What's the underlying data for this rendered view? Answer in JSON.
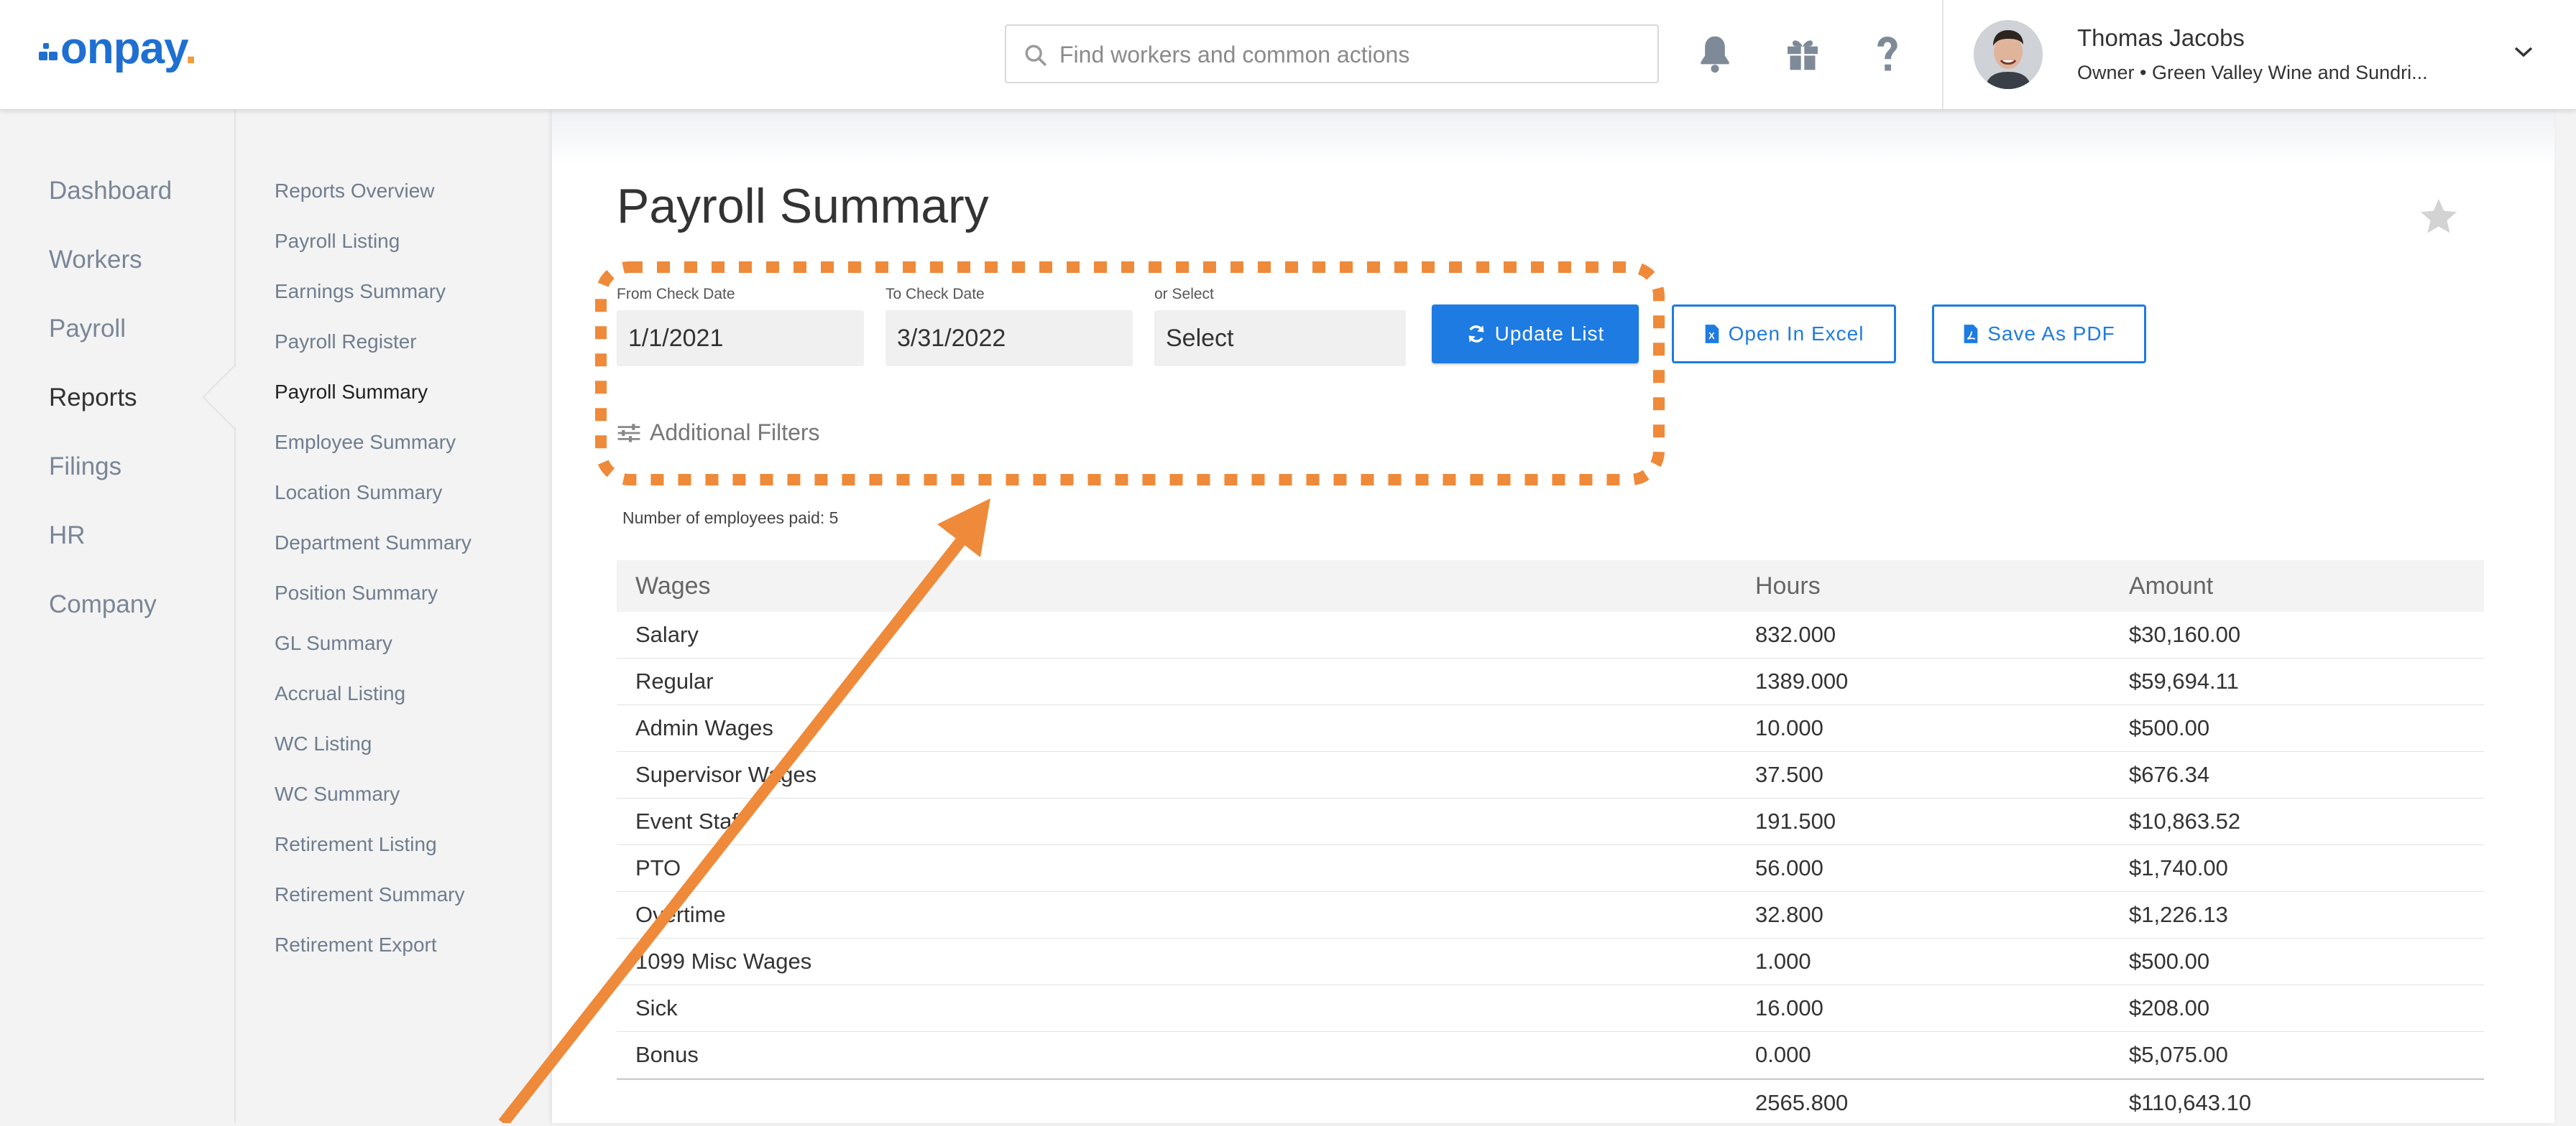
{
  "app": {
    "logo_text": "onpay",
    "logo_dot": "."
  },
  "header": {
    "search_placeholder": "Find workers and common actions",
    "user_name": "Thomas Jacobs",
    "user_sub": "Owner • Green Valley Wine and Sundri..."
  },
  "nav_primary": [
    {
      "label": "Dashboard"
    },
    {
      "label": "Workers"
    },
    {
      "label": "Payroll"
    },
    {
      "label": "Reports"
    },
    {
      "label": "Filings"
    },
    {
      "label": "HR"
    },
    {
      "label": "Company"
    }
  ],
  "nav_reports": [
    {
      "label": "Reports Overview"
    },
    {
      "label": "Payroll Listing"
    },
    {
      "label": "Earnings Summary"
    },
    {
      "label": "Payroll Register"
    },
    {
      "label": "Payroll Summary"
    },
    {
      "label": "Employee Summary"
    },
    {
      "label": "Location Summary"
    },
    {
      "label": "Department Summary"
    },
    {
      "label": "Position Summary"
    },
    {
      "label": "GL Summary"
    },
    {
      "label": "Accrual Listing"
    },
    {
      "label": "WC Listing"
    },
    {
      "label": "WC Summary"
    },
    {
      "label": "Retirement Listing"
    },
    {
      "label": "Retirement Summary"
    },
    {
      "label": "Retirement Export"
    }
  ],
  "page": {
    "title": "Payroll Summary",
    "from_label": "From Check Date",
    "from_value": "1/1/2021",
    "to_label": "To Check Date",
    "to_value": "3/31/2022",
    "or_select_label": "or Select",
    "select_value": "Select",
    "update_button": "Update List",
    "excel_button": "Open In Excel",
    "pdf_button": "Save As PDF",
    "additional_filters": "Additional Filters",
    "employee_count": "Number of employees paid: 5"
  },
  "table": {
    "headers": [
      "Wages",
      "Hours",
      "Amount"
    ],
    "rows": [
      [
        "Salary",
        "832.000",
        "$30,160.00"
      ],
      [
        "Regular",
        "1389.000",
        "$59,694.11"
      ],
      [
        "Admin Wages",
        "10.000",
        "$500.00"
      ],
      [
        "Supervisor Wages",
        "37.500",
        "$676.34"
      ],
      [
        "Event Staff",
        "191.500",
        "$10,863.52"
      ],
      [
        "PTO",
        "56.000",
        "$1,740.00"
      ],
      [
        "Overtime",
        "32.800",
        "$1,226.13"
      ],
      [
        "1099 Misc Wages",
        "1.000",
        "$500.00"
      ],
      [
        "Sick",
        "16.000",
        "$208.00"
      ],
      [
        "Bonus",
        "0.000",
        "$5,075.00"
      ]
    ],
    "total": [
      "",
      "2565.800",
      "$110,643.10"
    ]
  },
  "colors": {
    "brand": "#1e6fd1",
    "button": "#1e7be2",
    "annotation": "#ee8a3a"
  }
}
